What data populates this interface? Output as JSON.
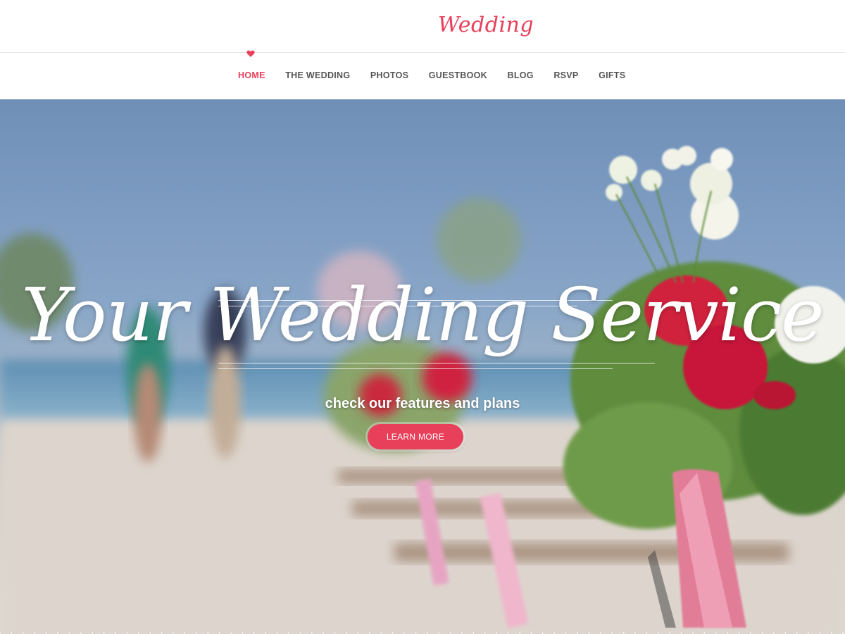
{
  "header": {
    "logo_text": "Wedding"
  },
  "nav": {
    "items": [
      {
        "label": "HOME",
        "active": true
      },
      {
        "label": "THE WEDDING",
        "active": false
      },
      {
        "label": "PHOTOS",
        "active": false
      },
      {
        "label": "GUESTBOOK",
        "active": false
      },
      {
        "label": "BLOG",
        "active": false
      },
      {
        "label": "RSVP",
        "active": false
      },
      {
        "label": "GIFTS",
        "active": false
      }
    ],
    "active_icon": "heart-icon"
  },
  "hero": {
    "title": "Your Wedding Service",
    "subtitle": "check our features and plans",
    "button_label": "LEARN MORE"
  },
  "colors": {
    "accent": "#e8405a",
    "nav_text": "#555555",
    "white": "#ffffff"
  }
}
